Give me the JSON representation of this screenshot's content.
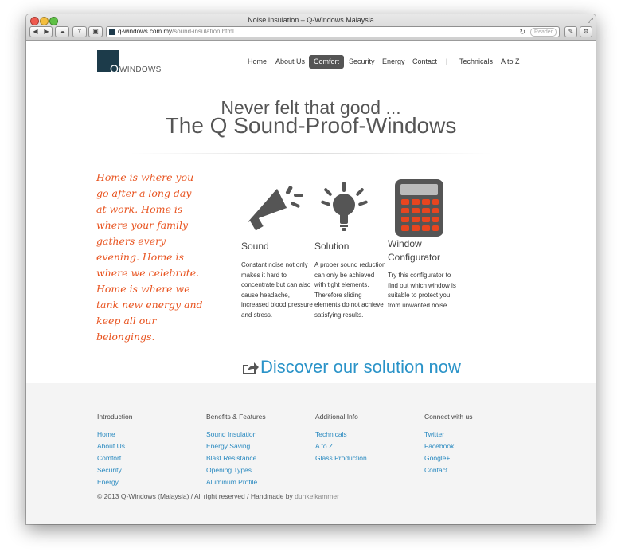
{
  "browser": {
    "title": "Noise Insulation – Q-Windows Malaysia",
    "url_domain": "q-windows.com.my",
    "url_path": "/sound-insulation.html",
    "reader_label": "Reader"
  },
  "logo": {
    "mark": "Q",
    "text": "WINDOWS"
  },
  "nav": {
    "items": [
      "Home",
      "About Us",
      "Comfort",
      "Security",
      "Energy",
      "Contact"
    ],
    "separator": "|",
    "items_right": [
      "Technicals",
      "A to Z"
    ],
    "active": "Comfort"
  },
  "hero": {
    "line1": "Never felt that good ...",
    "line2": "The Q Sound-Proof-Windows"
  },
  "quote": "Home is where you go after a long day at work. Home is where your family gathers every evening. Home is where we celebrate. Home is where we tank new energy and keep all our belongings.",
  "features": [
    {
      "icon": "megaphone-icon",
      "title": "Sound",
      "text": "Constant noise not only makes it hard to concentrate but can also cause headache, increased blood pressure and stress."
    },
    {
      "icon": "lightbulb-icon",
      "title": "Solution",
      "text": "A proper sound reduction can only be achieved with tight elements. Therefore sliding elements do not achieve satisfying results."
    },
    {
      "icon": "calculator-icon",
      "title": "Window Configurator",
      "text": "Try this configurator to find out which window is suitable to protect you from unwanted noise."
    }
  ],
  "cta": "Discover our solution now",
  "footer": {
    "columns": [
      {
        "heading": "Introduction",
        "links": [
          "Home",
          "About Us",
          "Comfort",
          "Security",
          "Energy"
        ]
      },
      {
        "heading": "Benefits & Features",
        "links": [
          "Sound Insulation",
          "Energy Saving",
          "Blast Resistance",
          "Opening Types",
          "Aluminum Profile"
        ]
      },
      {
        "heading": "Additional Info",
        "links": [
          "Technicals",
          "A to Z",
          "Glass Production"
        ]
      },
      {
        "heading": "Connect with us",
        "links": [
          "Twitter",
          "Facebook",
          "Google+",
          "Contact"
        ]
      }
    ],
    "copyright": "© 2013 Q-Windows (Malaysia) / All right reserved / Handmade by",
    "credit": "dunkelkammer"
  },
  "colors": {
    "accent_orange": "#e8531f",
    "link_blue": "#2a8ac0",
    "icon_gray": "#555555",
    "calculator_keys": "#e8451f"
  }
}
